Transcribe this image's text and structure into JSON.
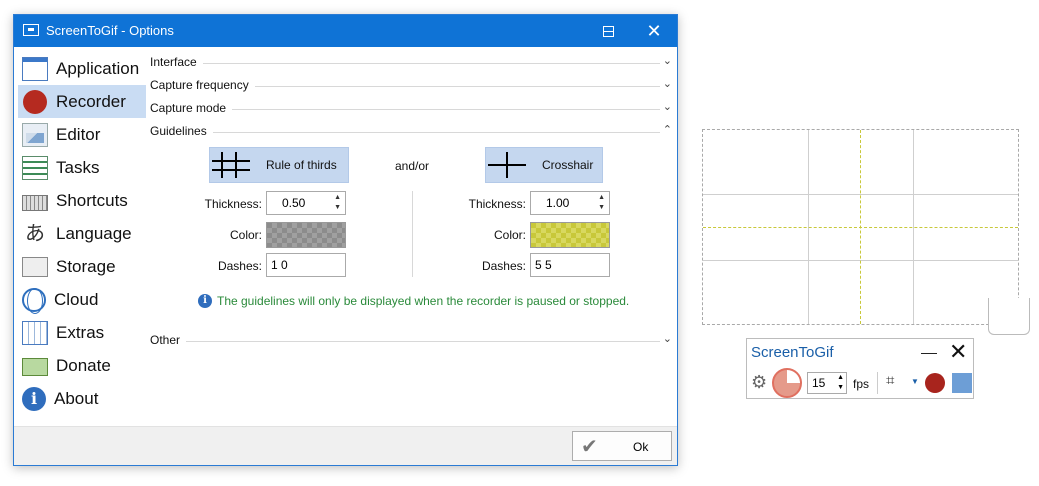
{
  "window": {
    "title": "ScreenToGif - Options",
    "accent": "#0f73d6"
  },
  "sidebar": {
    "items": [
      {
        "label": "Application",
        "icon": "application-icon"
      },
      {
        "label": "Recorder",
        "icon": "recorder-icon",
        "selected": true
      },
      {
        "label": "Editor",
        "icon": "editor-icon"
      },
      {
        "label": "Tasks",
        "icon": "tasks-icon"
      },
      {
        "label": "Shortcuts",
        "icon": "keyboard-icon"
      },
      {
        "label": "Language",
        "icon": "language-icon"
      },
      {
        "label": "Storage",
        "icon": "storage-icon"
      },
      {
        "label": "Cloud",
        "icon": "globe-icon"
      },
      {
        "label": "Extras",
        "icon": "extras-icon"
      },
      {
        "label": "Donate",
        "icon": "donate-icon"
      },
      {
        "label": "About",
        "icon": "info-icon"
      }
    ]
  },
  "sections": {
    "interface": "Interface",
    "capture_frequency": "Capture frequency",
    "capture_mode": "Capture mode",
    "guidelines": "Guidelines",
    "other": "Other"
  },
  "guidelines": {
    "rule_of_thirds": {
      "button": "Rule of thirds",
      "thickness_label": "Thickness:",
      "thickness": "0.50",
      "color_label": "Color:",
      "color": "#8c8c8c",
      "dashes_label": "Dashes:",
      "dashes": "1 0"
    },
    "and_or": "and/or",
    "crosshair": {
      "button": "Crosshair",
      "thickness_label": "Thickness:",
      "thickness": "1.00",
      "color_label": "Color:",
      "color": "#c8c83a",
      "dashes_label": "Dashes:",
      "dashes": "5 5"
    },
    "info": "The guidelines will only be displayed when the recorder is paused or stopped."
  },
  "footer": {
    "ok": "Ok"
  },
  "recorder": {
    "title": "ScreenToGif",
    "fps": "15",
    "fps_label": "fps"
  }
}
